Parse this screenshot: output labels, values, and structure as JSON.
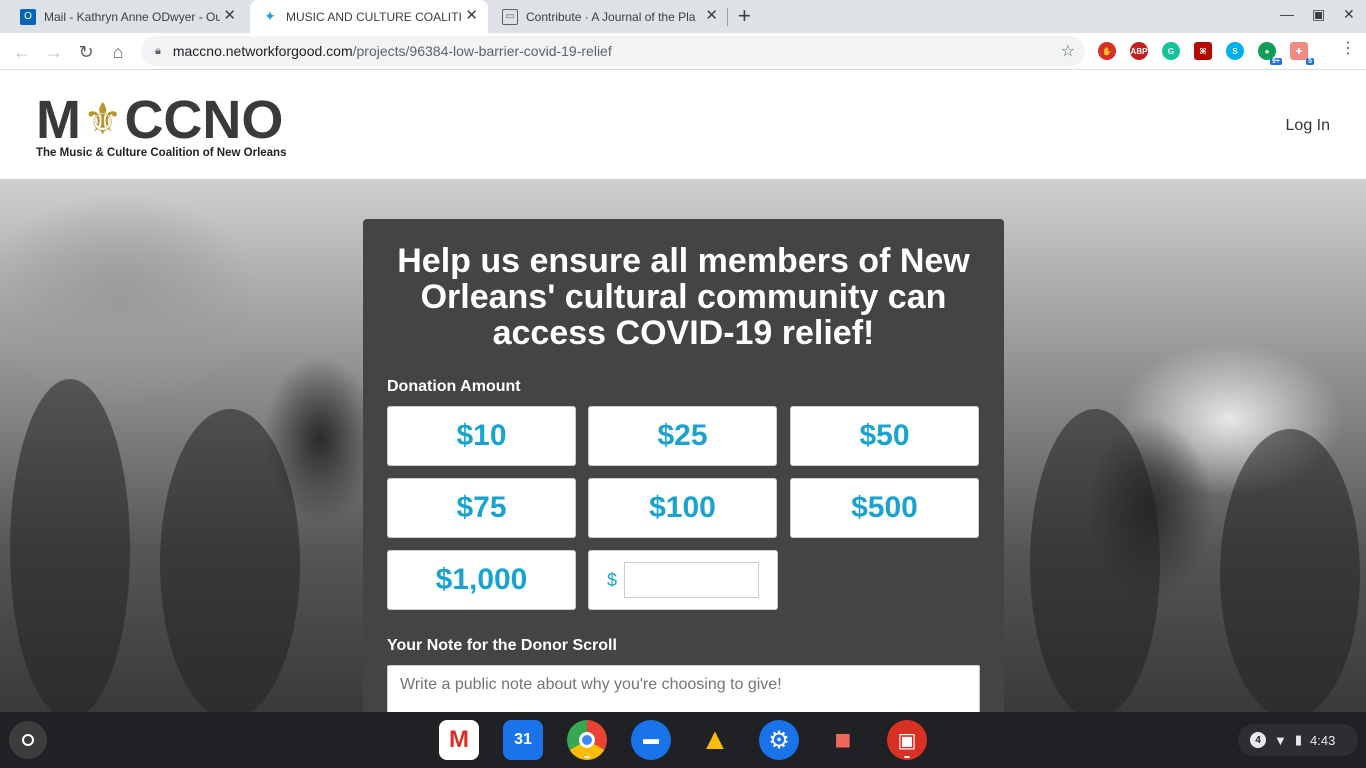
{
  "browser": {
    "tabs": [
      {
        "title": "Mail - Kathryn Anne ODwyer - Ou",
        "icon": "outlook-icon",
        "active": false
      },
      {
        "title": "MUSIC AND CULTURE COALITIO",
        "icon": "dancer-icon",
        "active": true
      },
      {
        "title": "Contribute · A Journal of the Pla",
        "icon": "page-icon",
        "active": false
      }
    ],
    "url_host": "maccno.networkforgood.com",
    "url_path": "/projects/96384-low-barrier-covid-19-relief",
    "extensions": [
      {
        "name": "stop-extension",
        "label": "",
        "color": "#d93025"
      },
      {
        "name": "adblock-extension",
        "label": "ABP",
        "color": "#c5221f"
      },
      {
        "name": "grammarly-extension",
        "label": "G",
        "color": "#15c39a"
      },
      {
        "name": "acrobat-extension",
        "label": "",
        "color": "#b30b00"
      },
      {
        "name": "skype-extension",
        "label": "S",
        "color": "#00aff0"
      },
      {
        "name": "chat-extension",
        "label": "",
        "color": "#0f9d58",
        "badge": "9+"
      },
      {
        "name": "puzzle-extension",
        "label": "",
        "color": "#f28b82",
        "badge": "5"
      }
    ]
  },
  "site": {
    "logo_text_left": "M",
    "logo_text_right": "CCNO",
    "logo_fleur": "⚜",
    "logo_subtitle": "The Music & Culture Coalition of New Orleans",
    "login_label": "Log In"
  },
  "donation": {
    "headline": "Help us ensure all members of New Orleans' cultural community can access COVID-19 relief!",
    "amount_label": "Donation Amount",
    "amounts": [
      "$10",
      "$25",
      "$50",
      "$75",
      "$100",
      "$500",
      "$1,000"
    ],
    "custom_currency": "$",
    "custom_value": "",
    "note_label": "Your Note for the Donor Scroll",
    "note_placeholder": "Write a public note about why you're choosing to give!"
  },
  "shelf": {
    "apps": [
      {
        "name": "gmail-icon",
        "label": "M",
        "color": "#ffffff",
        "fg": "#d93025"
      },
      {
        "name": "calendar-icon",
        "label": "31",
        "color": "#1a73e8",
        "fg": "#ffffff"
      },
      {
        "name": "chrome-icon",
        "label": "",
        "color": "#34a853",
        "fg": "#ffffff"
      },
      {
        "name": "files-icon",
        "label": "",
        "color": "#1a73e8",
        "fg": "#ffffff"
      },
      {
        "name": "drive-icon",
        "label": "▲",
        "color": "#202124",
        "fg": "#fbbc04"
      },
      {
        "name": "settings-icon",
        "label": "⚙",
        "color": "#1a73e8",
        "fg": "#ffffff"
      },
      {
        "name": "screencast-icon",
        "label": "■",
        "color": "#202124",
        "fg": "#ee675c"
      },
      {
        "name": "gallery-icon",
        "label": "▣",
        "color": "#d93025",
        "fg": "#ffffff"
      }
    ],
    "notification_count": "4",
    "time": "4:43"
  }
}
